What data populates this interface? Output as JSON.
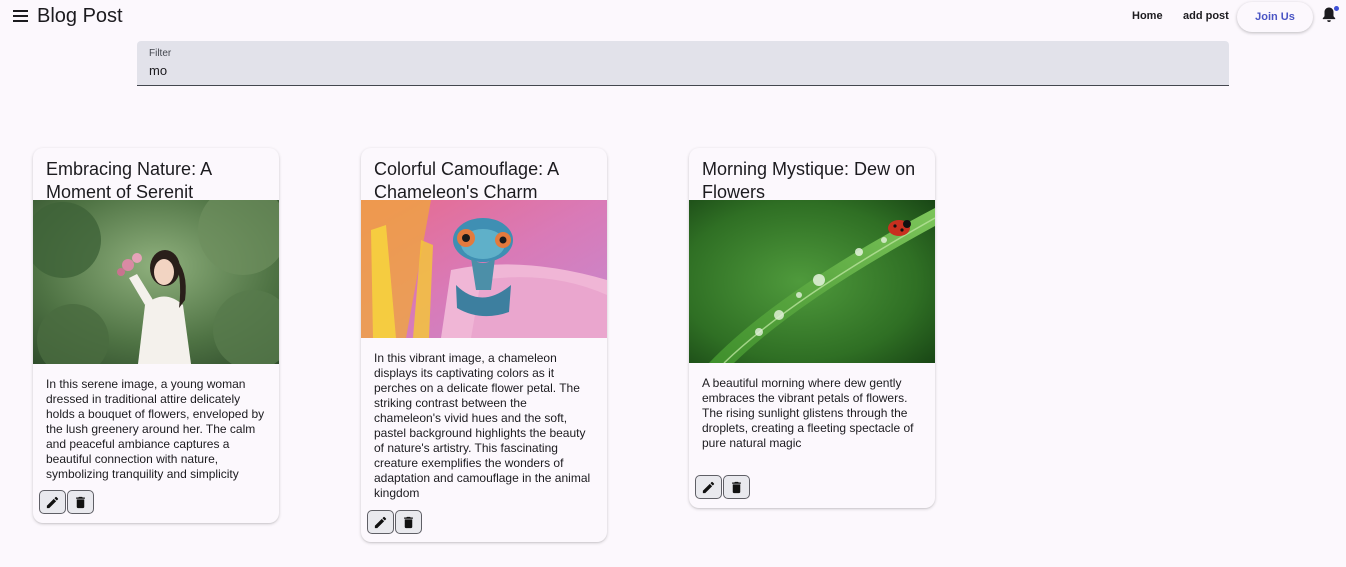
{
  "header": {
    "title": "Blog Post",
    "nav": {
      "home": "Home",
      "add_post": "add post",
      "join": "Join Us"
    }
  },
  "filter": {
    "label": "Filter",
    "value": "mo"
  },
  "posts": [
    {
      "title": "Embracing Nature: A Moment of Serenit",
      "image": "woman-with-flowers-photo",
      "body": "In this serene image, a young woman dressed in traditional attire delicately holds a bouquet of flowers, enveloped by the lush greenery around her. The calm and peaceful ambiance captures a beautiful connection with nature, symbolizing tranquility and simplicity"
    },
    {
      "title": "Colorful Camouflage: A Chameleon's Charm",
      "image": "chameleon-on-flower-photo",
      "body": "In this vibrant image, a chameleon displays its captivating colors as it perches on a delicate flower petal. The striking contrast between the chameleon's vivid hues and the soft, pastel background highlights the beauty of nature's artistry. This fascinating creature exemplifies the wonders of adaptation and camouflage in the animal kingdom"
    },
    {
      "title": "Morning Mystique: Dew on Flowers",
      "image": "ladybug-on-dewy-leaf-photo",
      "body": "A beautiful morning where dew gently embraces the vibrant petals of flowers. The rising sunlight glistens through the droplets, creating a fleeting spectacle of pure natural magic"
    }
  ],
  "icons": {
    "menu": "menu-icon",
    "notifications": "bell-icon",
    "edit": "pencil-icon",
    "delete": "trash-icon"
  },
  "colors": {
    "accent": "#4a55c4",
    "background": "#fcf8fd",
    "notification_dot": "#3f51d8"
  }
}
